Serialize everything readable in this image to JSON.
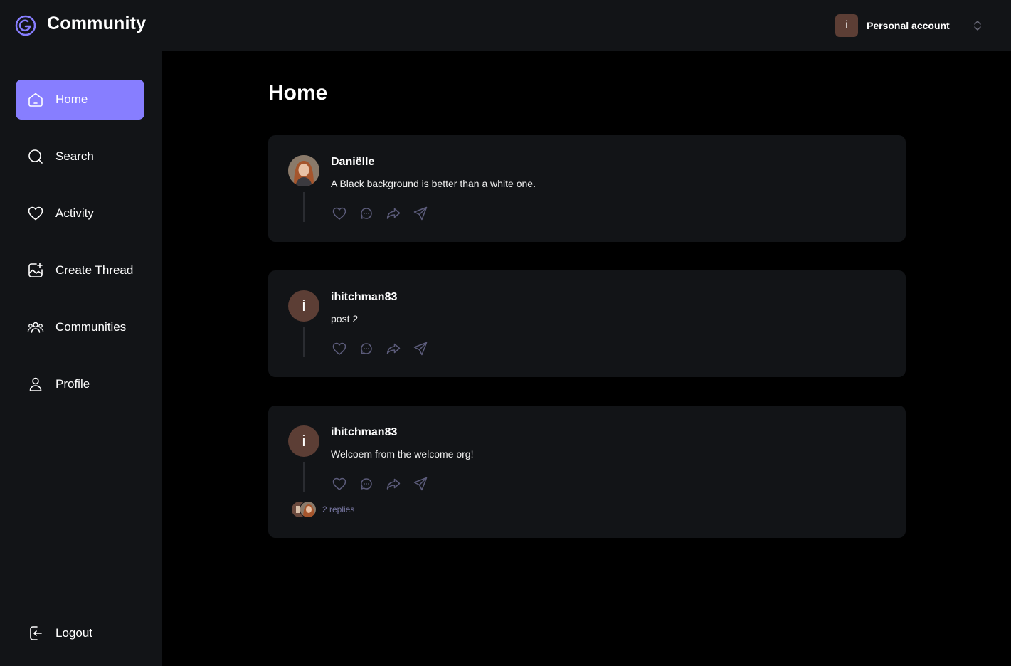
{
  "app": {
    "title": "Community"
  },
  "account": {
    "avatar_letter": "i",
    "label": "Personal account"
  },
  "sidebar": {
    "items": [
      {
        "label": "Home",
        "icon": "home-icon",
        "active": true
      },
      {
        "label": "Search",
        "icon": "search-icon",
        "active": false
      },
      {
        "label": "Activity",
        "icon": "heart-icon",
        "active": false
      },
      {
        "label": "Create Thread",
        "icon": "create-image-icon",
        "active": false
      },
      {
        "label": "Communities",
        "icon": "users-icon",
        "active": false
      },
      {
        "label": "Profile",
        "icon": "user-icon",
        "active": false
      }
    ],
    "logout_label": "Logout"
  },
  "page": {
    "title": "Home"
  },
  "threads": [
    {
      "author": "Daniëlle",
      "avatar": "photo",
      "content": "A Black background is better than a white one."
    },
    {
      "author": "ihitchman83",
      "avatar_letter": "i",
      "content": "post 2"
    },
    {
      "author": "ihitchman83",
      "avatar_letter": "i",
      "content": "Welcoem from the welcome org!",
      "replies_label": "2 replies"
    }
  ],
  "colors": {
    "accent": "#877eff",
    "panel": "#121417",
    "background": "#000000",
    "avatar_brown": "#5c3e35",
    "muted": "#7878a3"
  }
}
